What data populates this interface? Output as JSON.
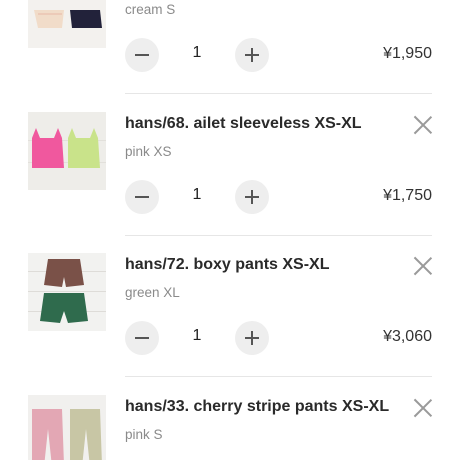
{
  "cart": {
    "items": [
      {
        "title": "",
        "variant": "cream S",
        "quantity": "1",
        "price": "¥1,950",
        "thumbnail_icon": "product-photo-tops-icon"
      },
      {
        "title": "hans/68. ailet sleeveless XS-XL",
        "variant": "pink XS",
        "quantity": "1",
        "price": "¥1,750",
        "thumbnail_icon": "product-photo-sleeveless-icon"
      },
      {
        "title": "hans/72. boxy pants XS-XL",
        "variant": "green XL",
        "quantity": "1",
        "price": "¥3,060",
        "thumbnail_icon": "product-photo-shorts-icon"
      },
      {
        "title": "hans/33. cherry stripe pants XS-XL",
        "variant": "pink S",
        "quantity": "",
        "price": "",
        "thumbnail_icon": "product-photo-pants-icon"
      }
    ],
    "colors": {
      "button_bg": "#eeeeee",
      "divider": "#e6e6e6",
      "variant_text": "#8a8a8a"
    }
  }
}
